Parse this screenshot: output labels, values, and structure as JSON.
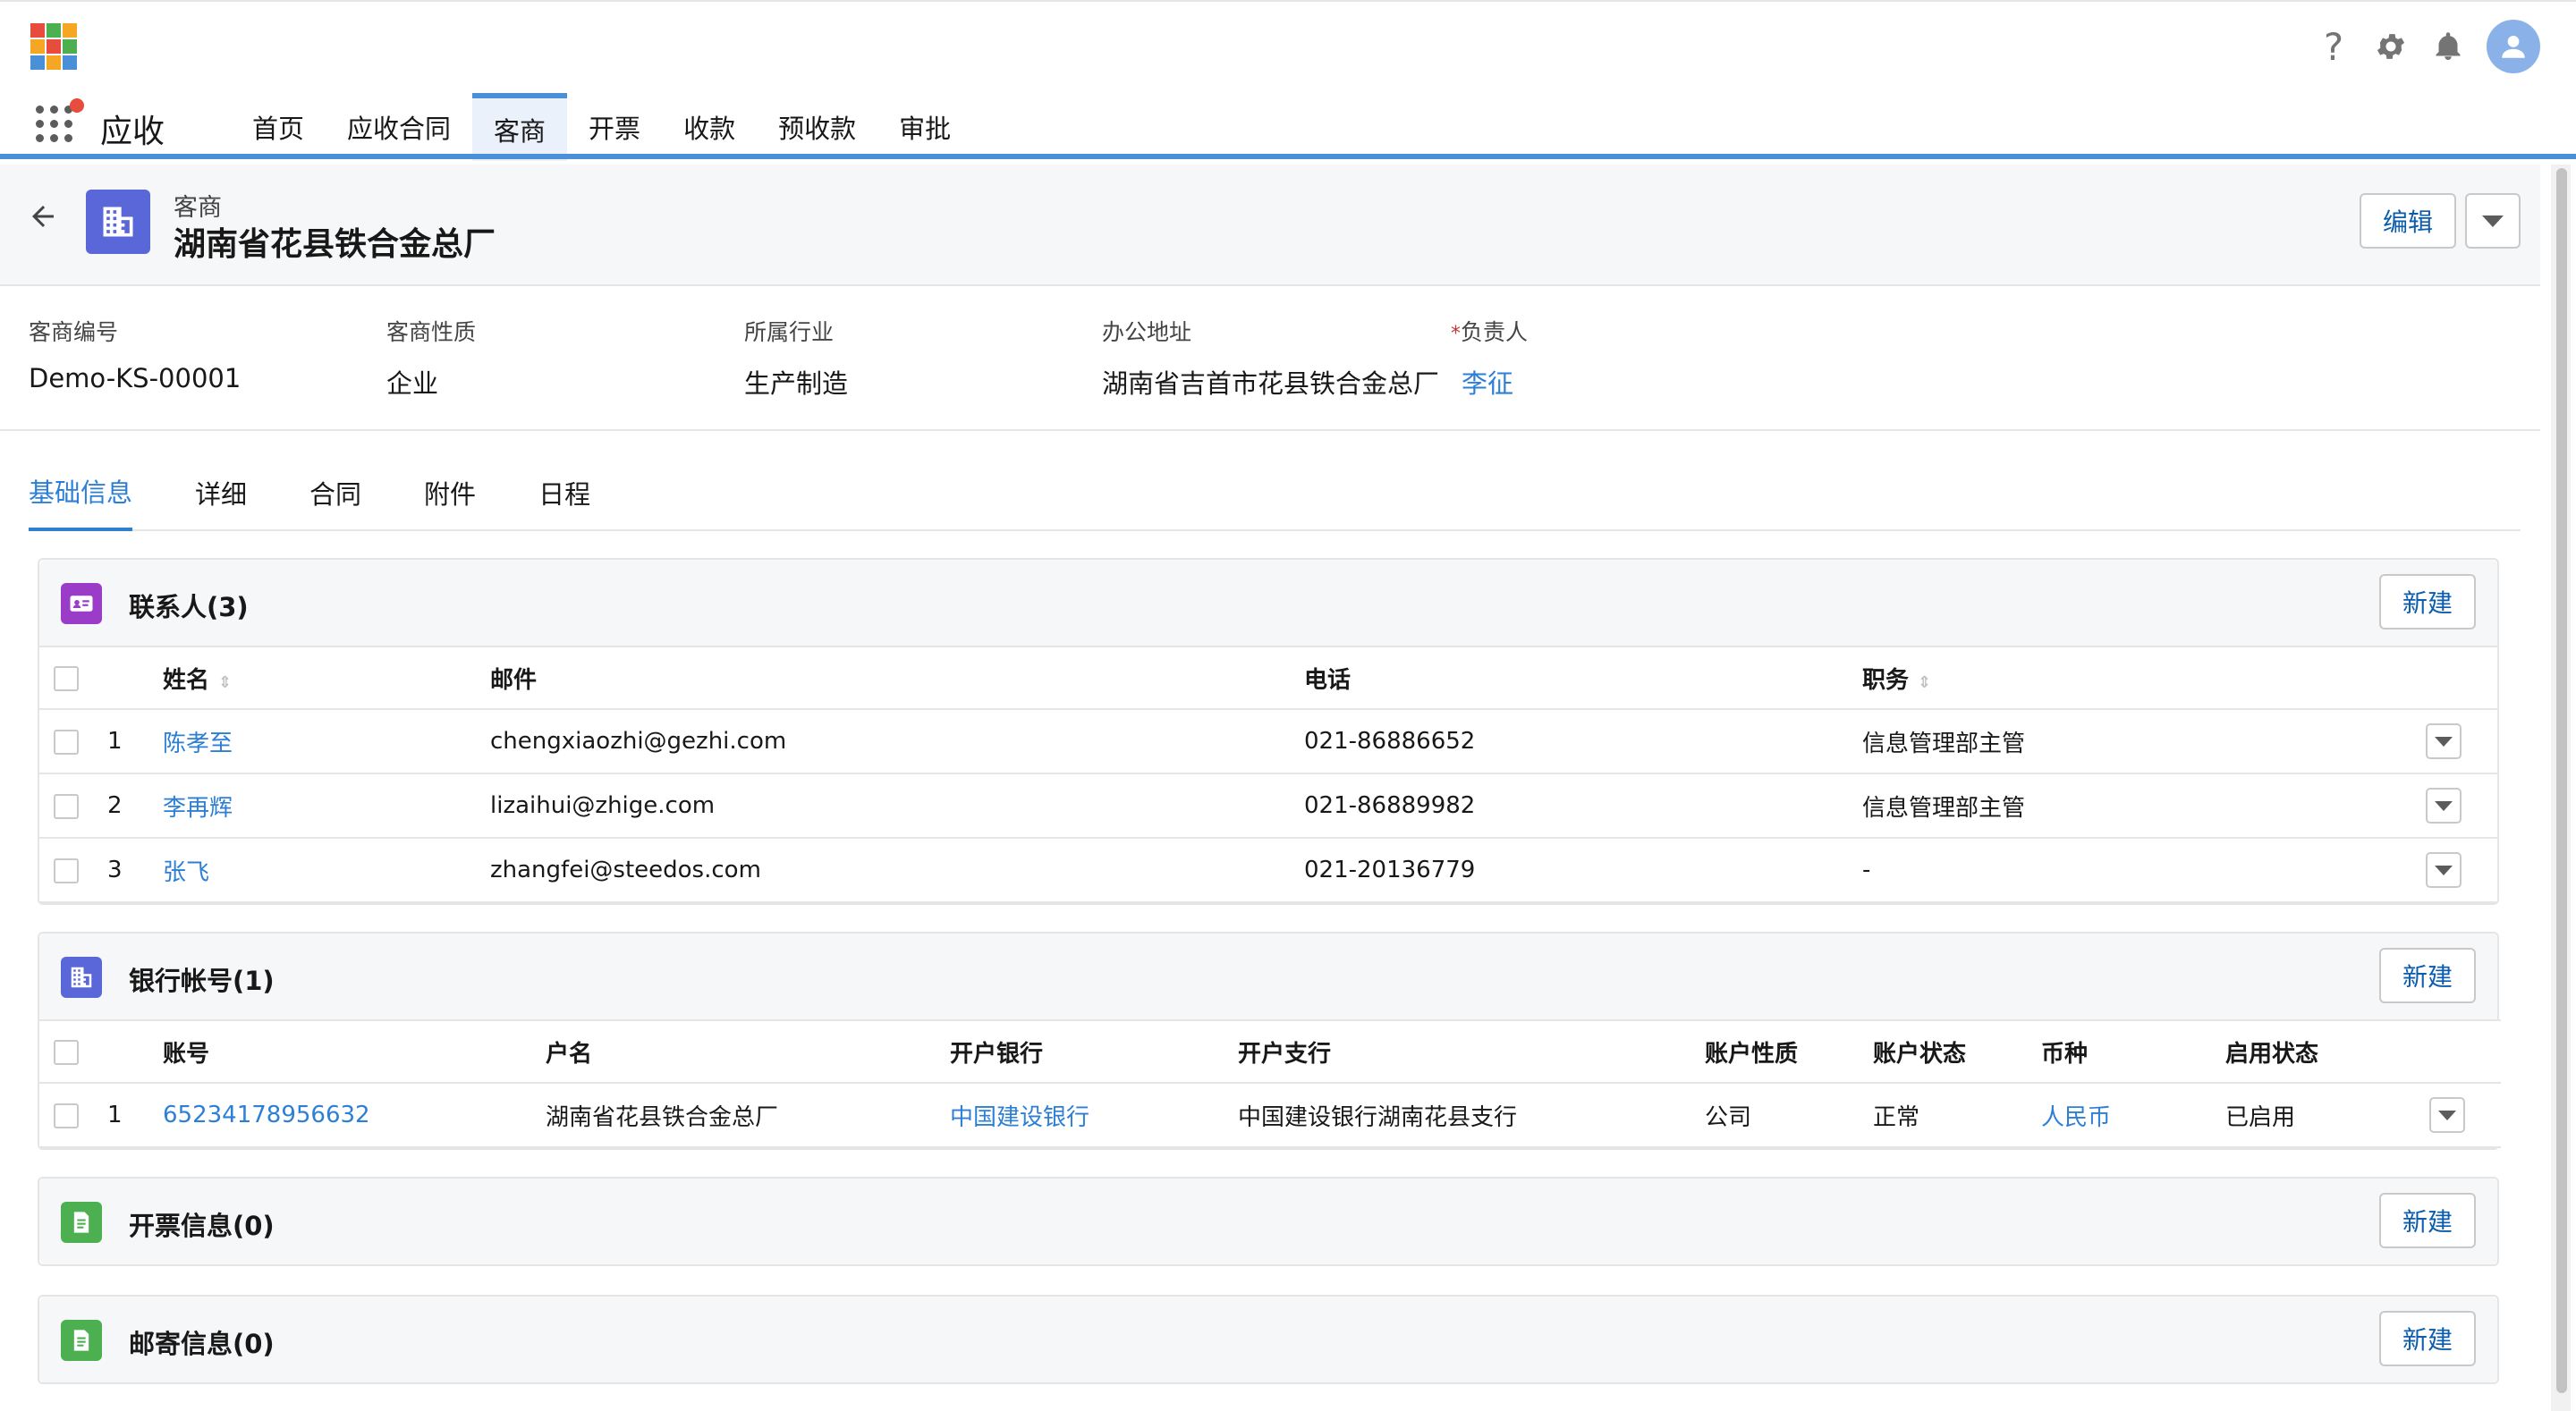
{
  "colors": {
    "accent": "#4a90d9",
    "link": "#2d7fd6",
    "contact_icon_bg": "#9b3cc9",
    "account_icon_bg": "#5a67d8",
    "invoice_icon_bg": "#4caf50"
  },
  "app": {
    "name": "应收"
  },
  "header_icons": [
    "help-icon",
    "gear-icon",
    "bell-icon",
    "user-avatar-icon"
  ],
  "nav": {
    "tabs": [
      {
        "label": "首页"
      },
      {
        "label": "应收合同"
      },
      {
        "label": "客商",
        "active": true
      },
      {
        "label": "开票"
      },
      {
        "label": "收款"
      },
      {
        "label": "预收款"
      },
      {
        "label": "审批"
      }
    ]
  },
  "record": {
    "type": "客商",
    "title": "湖南省花县铁合金总厂",
    "edit_label": "编辑"
  },
  "highlights": [
    {
      "label": "客商编号",
      "value": "Demo-KS-00001",
      "required": false,
      "link": false
    },
    {
      "label": "客商性质",
      "value": "企业",
      "required": false,
      "link": false
    },
    {
      "label": "所属行业",
      "value": "生产制造",
      "required": false,
      "link": false
    },
    {
      "label": "办公地址",
      "value": "湖南省吉首市花县铁合金总厂",
      "required": false,
      "link": false
    },
    {
      "label": "负责人",
      "value": "李征",
      "required": true,
      "link": true
    }
  ],
  "detail_tabs": [
    {
      "label": "基础信息",
      "active": true
    },
    {
      "label": "详细"
    },
    {
      "label": "合同"
    },
    {
      "label": "附件"
    },
    {
      "label": "日程"
    }
  ],
  "contacts": {
    "title": "联系人(3)",
    "new_label": "新建",
    "columns": [
      "姓名",
      "邮件",
      "电话",
      "职务"
    ],
    "rows": [
      {
        "index": "1",
        "name": "陈孝至",
        "email": "chengxiaozhi@gezhi.com",
        "phone": "021-86886652",
        "title": "信息管理部主管"
      },
      {
        "index": "2",
        "name": "李再辉",
        "email": "lizaihui@zhige.com",
        "phone": "021-86889982",
        "title": "信息管理部主管"
      },
      {
        "index": "3",
        "name": "张飞",
        "email": "zhangfei@steedos.com",
        "phone": "021-20136779",
        "title": "-"
      }
    ]
  },
  "bank_accounts": {
    "title": "银行帐号(1)",
    "new_label": "新建",
    "columns": [
      "账号",
      "户名",
      "开户银行",
      "开户支行",
      "账户性质",
      "账户状态",
      "币种",
      "启用状态"
    ],
    "rows": [
      {
        "index": "1",
        "account": "65234178956632",
        "holder": "湖南省花县铁合金总厂",
        "bank": "中国建设银行",
        "branch": "中国建设银行湖南花县支行",
        "nature": "公司",
        "status": "正常",
        "currency": "人民币",
        "enabled": "已启用"
      }
    ]
  },
  "invoices": {
    "title": "开票信息(0)",
    "new_label": "新建"
  },
  "mailing": {
    "title": "邮寄信息(0)",
    "new_label": "新建"
  }
}
